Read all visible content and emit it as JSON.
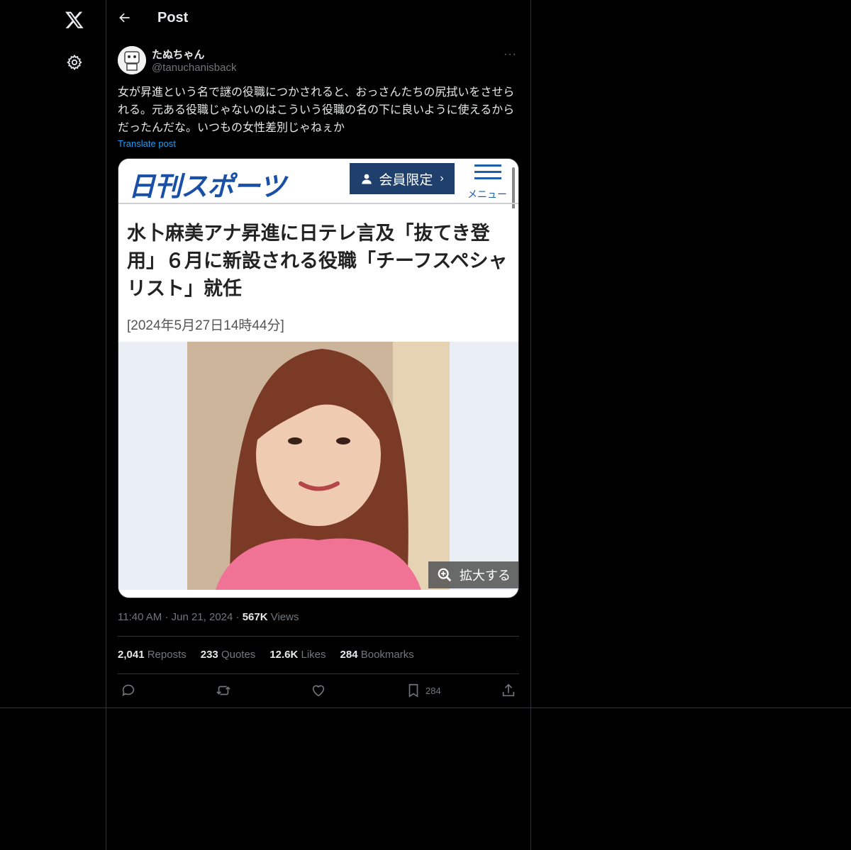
{
  "nav": {
    "logo_icon": "x-logo-icon",
    "settings_icon": "gear-icon"
  },
  "header": {
    "title": "Post",
    "back_icon": "arrow-left-icon"
  },
  "post": {
    "author_name": "たぬちゃん",
    "author_handle": "@tanuchanisback",
    "more_label": "···",
    "text": "女が昇進という名で謎の役職につかされると、おっさんたちの尻拭いをさせられる。元ある役職じゃないのはこういう役職の名の下に良いように使えるからだったんだな。いつもの女性差別じゃねぇか",
    "translate_label": "Translate post",
    "time": "11:40 AM",
    "date": "Jun 21, 2024",
    "views_count": "567K",
    "views_label": " Views",
    "stats": {
      "reposts_count": "2,041",
      "reposts_label": " Reposts",
      "quotes_count": "233",
      "quotes_label": " Quotes",
      "likes_count": "12.6K",
      "likes_label": " Likes",
      "bookmarks_count": "284",
      "bookmarks_label": " Bookmarks"
    },
    "actions": {
      "bookmark_count": "284"
    }
  },
  "media": {
    "logo_text": "日刊スポーツ",
    "member_label": "会員限定",
    "member_chevron": "›",
    "menu_label": "メニュー",
    "headline": "水卜麻美アナ昇進に日テレ言及「抜てき登用」６月に新設される役職「チーフスペシャリスト」就任",
    "date": "[2024年5月27日14時44分]",
    "zoom_label": "拡大する"
  },
  "colors": {
    "accent": "#1d9bf0",
    "muted": "#71767b",
    "text": "#e7e9ea",
    "border": "#2f3336"
  }
}
